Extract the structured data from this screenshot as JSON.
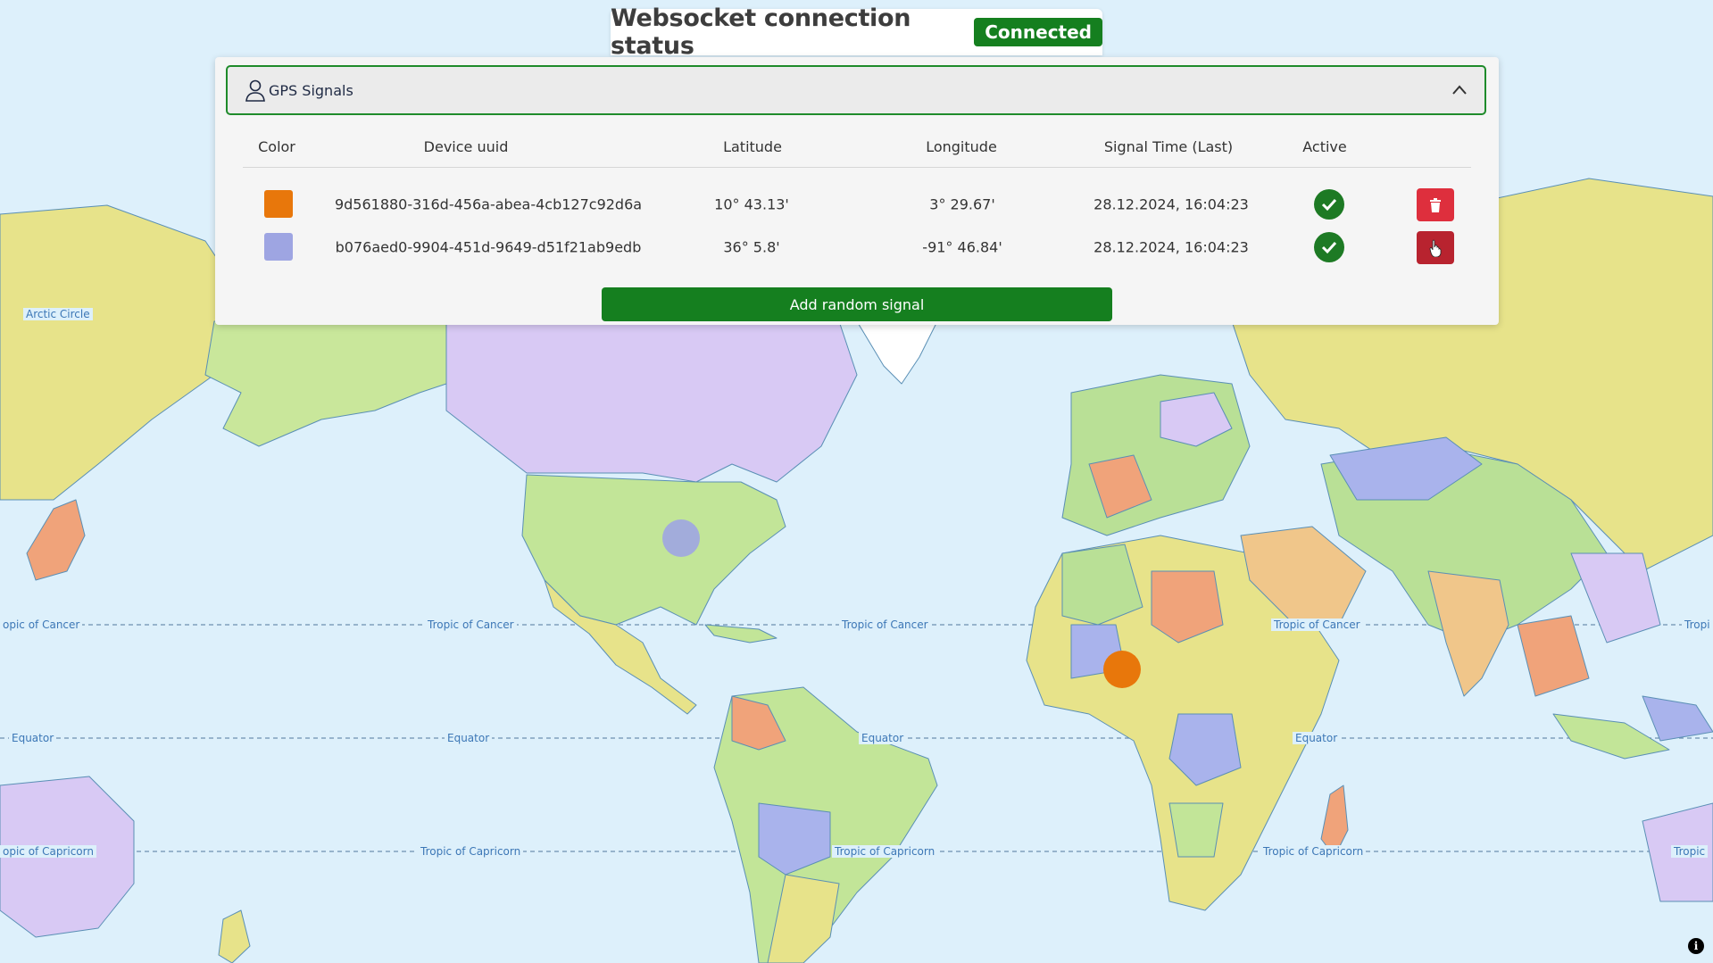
{
  "header": {
    "title": "Websocket connection status",
    "status_badge": "Connected",
    "status_color": "#157f1f"
  },
  "panel": {
    "title": "GPS Signals",
    "columns": {
      "color": "Color",
      "uuid": "Device uuid",
      "lat": "Latitude",
      "lon": "Longitude",
      "time": "Signal Time (Last)",
      "active": "Active"
    },
    "rows": [
      {
        "color": "#e8770b",
        "uuid": "9d561880-316d-456a-abea-4cb127c92d6a",
        "lat": "10° 43.13'",
        "lon": "3° 29.67'",
        "time": "28.12.2024, 16:04:23",
        "active": true
      },
      {
        "color": "#9ea5e2",
        "uuid": "b076aed0-9904-451d-9649-d51f21ab9edb",
        "lat": "36° 5.8'",
        "lon": "-91° 46.84'",
        "time": "28.12.2024, 16:04:23",
        "active": true
      }
    ],
    "add_button": "Add random signal"
  },
  "map": {
    "labels": {
      "arctic_circle": "Arctic Circle",
      "tropic_cancer": "Tropic of Cancer",
      "equator": "Equator",
      "tropic_capricorn": "Tropic of Capricorn",
      "tropic_cancer_cut_left": "opic of Cancer",
      "tropic_capricorn_cut_left": "opic of Capricorn",
      "tropic_cut_right": "Tropi",
      "tropic_capricorn_cut_right": "Tropic"
    },
    "ocean_color": "#ddf0fb"
  },
  "info_icon": "i"
}
